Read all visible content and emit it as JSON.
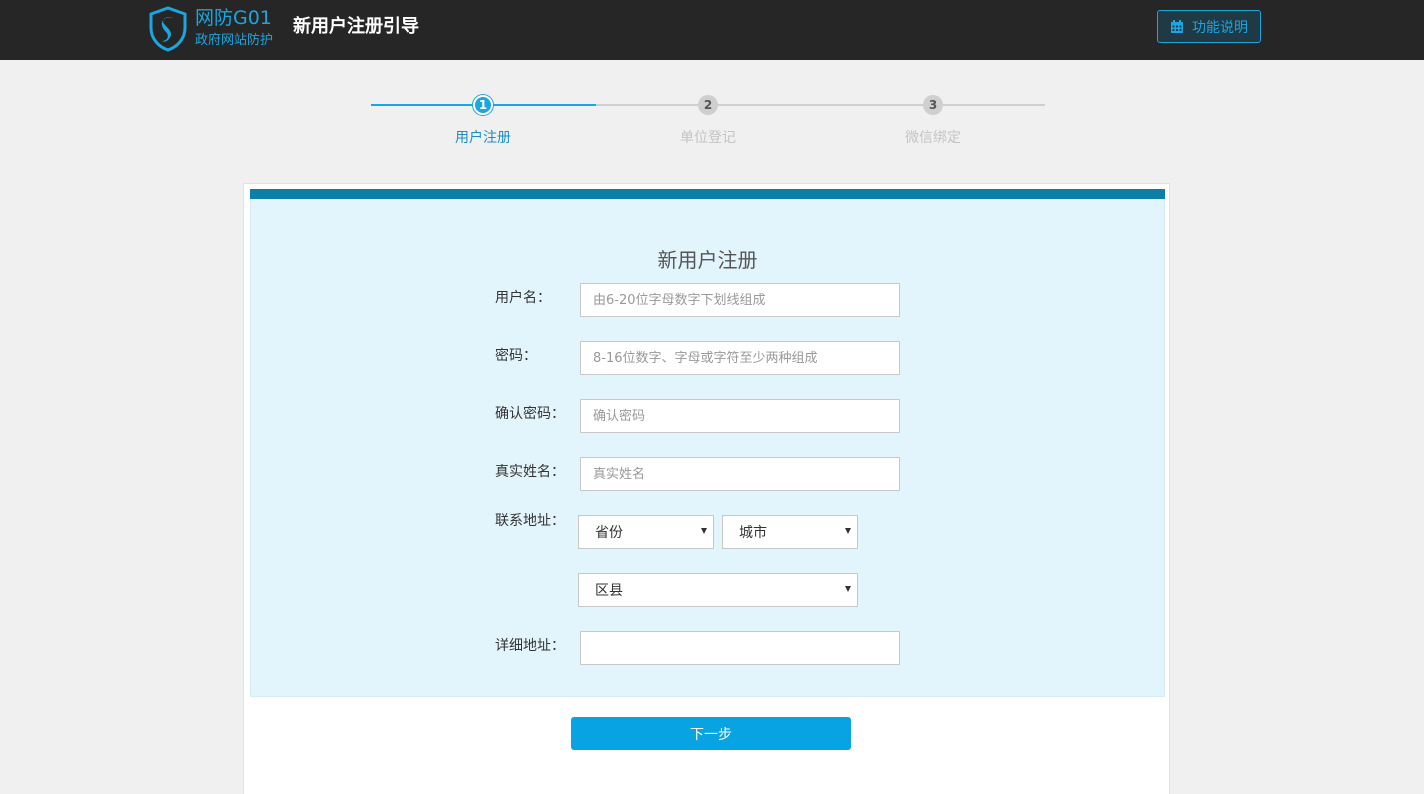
{
  "header": {
    "brand_name": "网防G01",
    "brand_sub": "政府网站防护",
    "page_title": "新用户注册引导",
    "help_button": "功能说明",
    "logo_icon": "shield-logo-icon",
    "help_icon": "calendar-icon"
  },
  "steps": [
    {
      "number": "1",
      "label": "用户注册",
      "state": "active"
    },
    {
      "number": "2",
      "label": "单位登记",
      "state": "inactive"
    },
    {
      "number": "3",
      "label": "微信绑定",
      "state": "inactive"
    }
  ],
  "form": {
    "title": "新用户注册",
    "username": {
      "label": "用户名：",
      "placeholder": "由6-20位字母数字下划线组成",
      "value": ""
    },
    "password": {
      "label": "密码：",
      "placeholder": "8-16位数字、字母或字符至少两种组成",
      "value": ""
    },
    "confirm_password": {
      "label": "确认密码：",
      "placeholder": "确认密码",
      "value": ""
    },
    "real_name": {
      "label": "真实姓名：",
      "placeholder": "真实姓名",
      "value": ""
    },
    "address": {
      "label": "联系地址：",
      "province": "省份",
      "city": "城市",
      "district": "区县"
    },
    "detail_address": {
      "label": "详细地址：",
      "placeholder": "",
      "value": ""
    },
    "next_button": "下一步"
  },
  "colors": {
    "accent": "#1aa6e0",
    "header_bg": "#262626",
    "panel_bg": "#e3f5fc",
    "panel_bar": "#0c7fa8",
    "button": "#08a3e3"
  }
}
